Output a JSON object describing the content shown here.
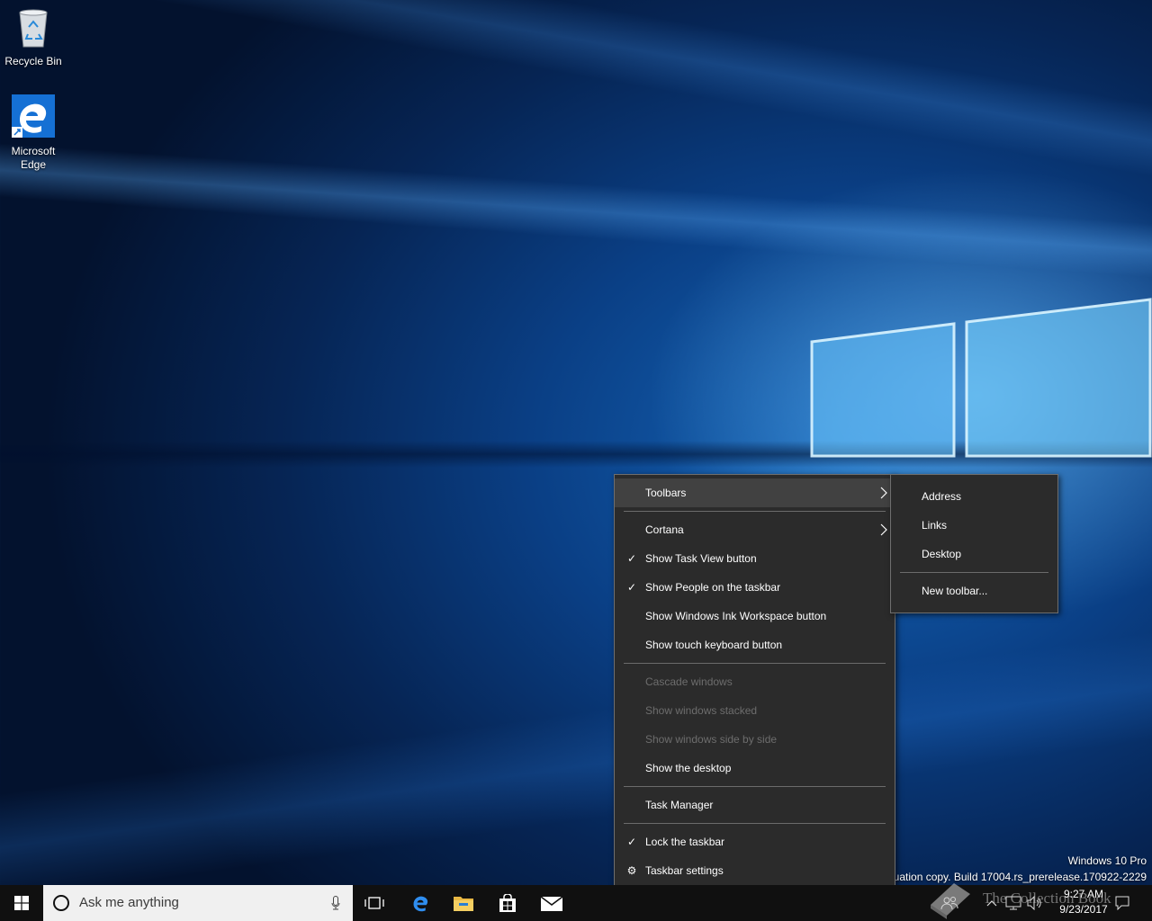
{
  "desktop": {
    "icons": [
      {
        "label": "Recycle Bin",
        "icon": "recycle-bin-icon"
      },
      {
        "label": "Microsoft Edge",
        "icon": "edge-icon"
      }
    ]
  },
  "context_menu": {
    "items": [
      {
        "label": "Toolbars",
        "submenu": true,
        "highlighted": true
      },
      {
        "label": "Cortana",
        "submenu": true
      },
      {
        "label": "Show Task View button",
        "checked": true
      },
      {
        "label": "Show People on the taskbar",
        "checked": true
      },
      {
        "label": "Show Windows Ink Workspace button"
      },
      {
        "label": "Show touch keyboard button"
      },
      {
        "label": "Cascade windows",
        "disabled": true
      },
      {
        "label": "Show windows stacked",
        "disabled": true
      },
      {
        "label": "Show windows side by side",
        "disabled": true
      },
      {
        "label": "Show the desktop"
      },
      {
        "label": "Task Manager"
      },
      {
        "label": "Lock the taskbar",
        "checked": true
      },
      {
        "label": "Taskbar settings",
        "icon": "gear-icon"
      }
    ]
  },
  "toolbars_submenu": {
    "items": [
      {
        "label": "Address"
      },
      {
        "label": "Links"
      },
      {
        "label": "Desktop"
      },
      {
        "label": "New toolbar..."
      }
    ]
  },
  "watermark": {
    "edition": "Windows 10 Pro",
    "build": "Evaluation copy. Build 17004.rs_prerelease.170922-2229",
    "site": "The Collection Book"
  },
  "taskbar": {
    "search_placeholder": "Ask me anything",
    "pinned": [
      "task-view-icon",
      "edge-icon",
      "file-explorer-icon",
      "store-icon",
      "mail-icon"
    ],
    "clock": {
      "time": "9:27 AM",
      "date": "9/23/2017"
    }
  },
  "colors": {
    "menu_bg": "#2b2b2b",
    "menu_highlight": "#414141",
    "taskbar_bg": "#101010",
    "edge_blue": "#1570d4"
  }
}
